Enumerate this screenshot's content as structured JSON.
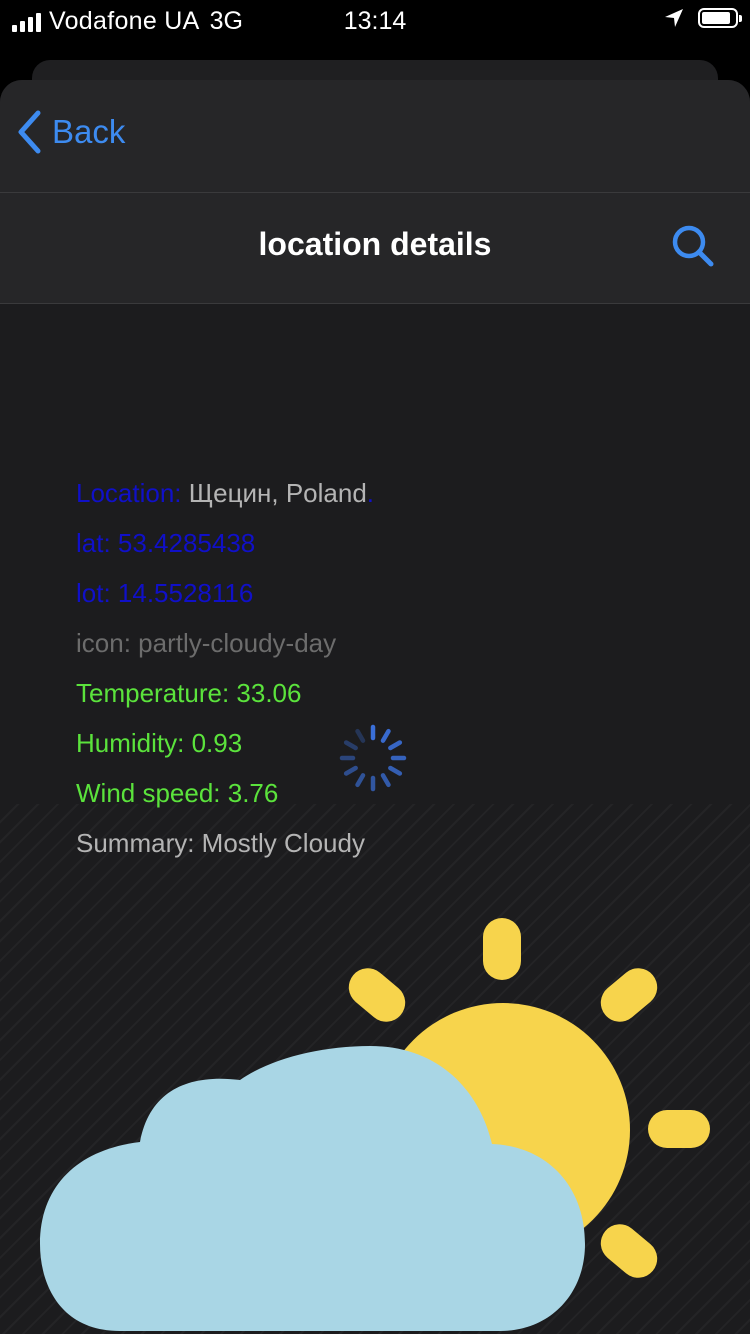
{
  "status_bar": {
    "carrier": "Vodafone UA",
    "network": "3G",
    "time": "13:14"
  },
  "nav": {
    "back_label": "Back",
    "title": "location details"
  },
  "details": {
    "location_label": "Location:",
    "location_value": "Щецин, Poland",
    "location_trailing": ".",
    "lat": "lat: 53.4285438",
    "lot": "lot: 14.5528116",
    "icon": "icon: partly-cloudy-day",
    "temperature": "Temperature: 33.06",
    "humidity": "Humidity: 0.93",
    "wind_speed": "Wind speed: 3.76",
    "summary": "Summary: Mostly Cloudy"
  },
  "colors": {
    "accent": "#3d8bf0",
    "label_blue": "#1010c8",
    "metric_green": "#5be33c",
    "sun_yellow": "#f7d44c",
    "cloud_blue": "#a9d6e5"
  },
  "icons": {
    "back": "chevron-left-icon",
    "search": "search-icon",
    "loading": "activity-spinner-icon",
    "weather": "partly-cloudy-day-icon"
  }
}
